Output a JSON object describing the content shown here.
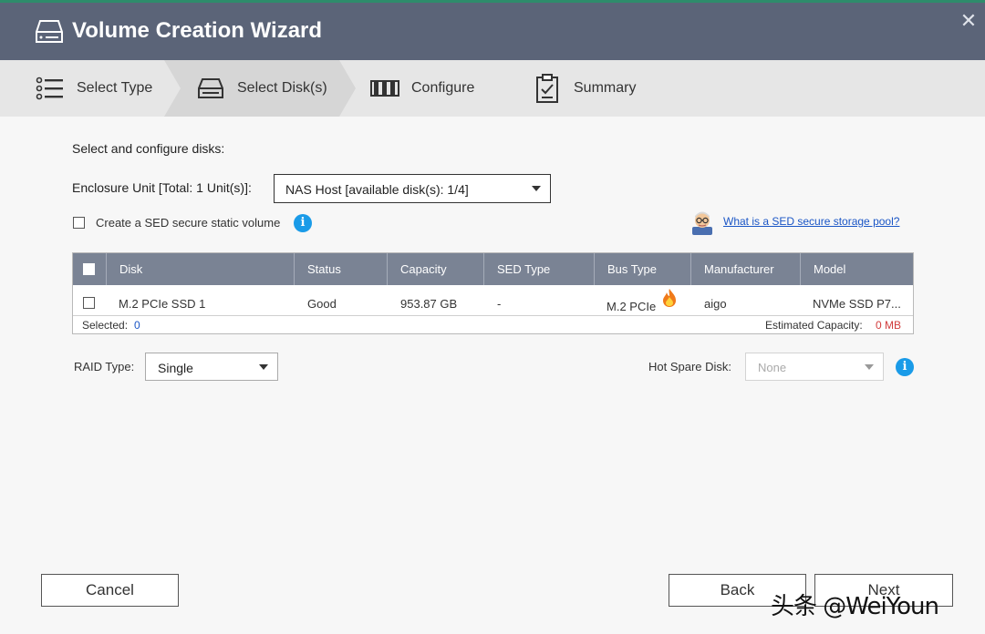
{
  "window": {
    "title": "Volume Creation Wizard",
    "close_glyph": "✕"
  },
  "steps": [
    {
      "label": "Select Type",
      "icon": "list-icon"
    },
    {
      "label": "Select Disk(s)",
      "icon": "disk-icon",
      "active": true
    },
    {
      "label": "Configure",
      "icon": "configure-icon"
    },
    {
      "label": "Summary",
      "icon": "clipboard-icon"
    }
  ],
  "main": {
    "section_title": "Select and configure disks:",
    "enclosure": {
      "label": "Enclosure Unit [Total: 1 Unit(s)]:",
      "value": "NAS Host [available disk(s): 1/4]"
    },
    "sed": {
      "label": "Create a SED secure static volume",
      "checked": false,
      "link": "What is a SED secure storage pool?"
    }
  },
  "table": {
    "headers": [
      "Disk",
      "Status",
      "Capacity",
      "SED Type",
      "Bus Type",
      "Manufacturer",
      "Model"
    ],
    "rows": [
      {
        "disk": "M.2 PCIe SSD 1",
        "status": "Good",
        "capacity": "953.87 GB",
        "sed_type": "-",
        "bus_type": "M.2 PCIe",
        "manufacturer": "aigo",
        "model": "NVMe SSD P7..."
      }
    ],
    "selected_label": "Selected:",
    "selected_value": "0",
    "estimated_label": "Estimated Capacity:",
    "estimated_value": "0 MB"
  },
  "raid": {
    "label": "RAID Type:",
    "value": "Single"
  },
  "hot_spare": {
    "label": "Hot Spare Disk:",
    "value": "None"
  },
  "buttons": {
    "cancel": "Cancel",
    "back": "Back",
    "next": "Next"
  },
  "watermark": "头条 @WeiYoun",
  "colors": {
    "titlebar": "#5b6478",
    "table_header": "#7a8394",
    "link": "#1b56c6",
    "info": "#1a9be8",
    "accent_red": "#d23c3c"
  }
}
